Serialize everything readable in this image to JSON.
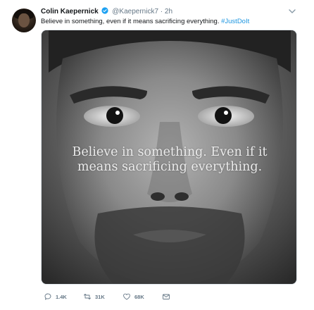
{
  "tweet": {
    "author_name": "Colin Kaepernick",
    "handle": "@Kaepernick7",
    "separator": "·",
    "time": "2h",
    "text": "Believe in something, even if it means sacrificing everything.",
    "hashtag": "#JustDoIt",
    "media": {
      "overlay_line1": "Believe in something. Even if it",
      "overlay_line2": "means sacrificing everything."
    },
    "actions": {
      "replies": "1.4K",
      "retweets": "31K",
      "likes": "68K"
    }
  },
  "icons": {
    "verified": "verified-badge-icon",
    "caret": "chevron-down-icon",
    "reply": "reply-icon",
    "retweet": "retweet-icon",
    "like": "heart-icon",
    "message": "envelope-icon"
  },
  "colors": {
    "verified": "#1da1f2",
    "hashtag": "#1b95e0",
    "muted": "#657786"
  }
}
